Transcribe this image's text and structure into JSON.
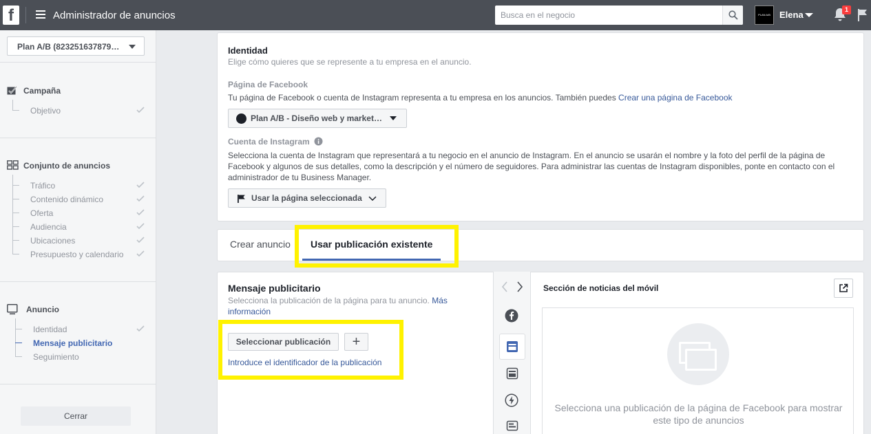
{
  "topbar": {
    "logo": "f",
    "title": "Administrador de anuncios",
    "search_placeholder": "Busca en el negocio",
    "avatar_text": "PLAN A/B",
    "user_name": "Elena",
    "notification_count": "1"
  },
  "sidebar": {
    "campaign_select": "Plan A/B (823251637879…",
    "sections": [
      {
        "title": "Campaña",
        "items": [
          {
            "label": "Objetivo"
          }
        ]
      },
      {
        "title": "Conjunto de anuncios",
        "items": [
          {
            "label": "Tráfico"
          },
          {
            "label": "Contenido dinámico"
          },
          {
            "label": "Oferta"
          },
          {
            "label": "Audiencia"
          },
          {
            "label": "Ubicaciones"
          },
          {
            "label": "Presupuesto y calendario"
          }
        ]
      },
      {
        "title": "Anuncio",
        "items": [
          {
            "label": "Identidad"
          },
          {
            "label": "Mensaje publicitario"
          },
          {
            "label": "Seguimiento"
          }
        ]
      }
    ],
    "close_label": "Cerrar"
  },
  "identity": {
    "title": "Identidad",
    "subtitle": "Elige cómo quieres que se represente a tu empresa en el anuncio.",
    "fb_page_label": "Página de Facebook",
    "fb_page_desc": "Tu página de Facebook o cuenta de Instagram representa a tu empresa en los anuncios. También puedes",
    "fb_page_link": "Crear una página de Facebook",
    "fb_page_select": "Plan A/B - Diseño web y market…",
    "ig_label": "Cuenta de Instagram",
    "ig_desc_1": "Selecciona la cuenta de Instagram que representará a tu negocio en el anuncio de Instagram. En el anuncio se usarán el nombre y la foto del perfil de la página de",
    "ig_desc_2": "Facebook y algunos de sus detalles, como la descripción y el número de seguidores. Para administrar las cuentas de Instagram disponibles, ponte en contacto con el",
    "ig_desc_3": "administrador de tu Business Manager.",
    "ig_select": "Usar la página seleccionada"
  },
  "tabs": [
    {
      "label": "Crear anuncio"
    },
    {
      "label": "Usar publicación existente"
    }
  ],
  "creative": {
    "title": "Mensaje publicitario",
    "desc_1": "Selecciona la publicación de la página para tu anuncio.",
    "desc_link_1": "Más",
    "desc_link_2": "información",
    "select_post_button": "Seleccionar publicación",
    "add_button": "+",
    "enter_id_link": "Introduce el identificador de la publicación"
  },
  "preview": {
    "placement_title": "Sección de noticias del móvil",
    "placeholder_line_1": "Selecciona una publicación de la página de Facebook para mostrar",
    "placeholder_line_2": "este tipo de anuncios"
  },
  "colors": {
    "highlight": "#fff200",
    "accent": "#4267b2",
    "topbar": "#4b4f56"
  }
}
